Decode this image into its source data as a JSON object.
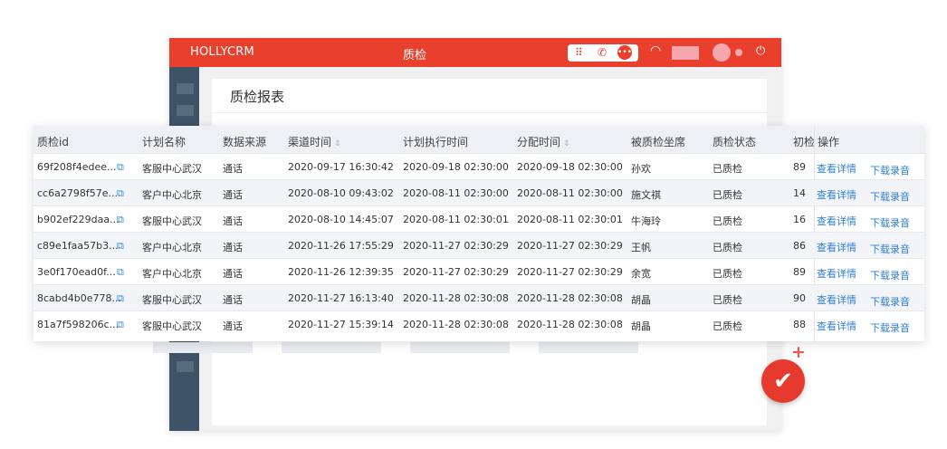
{
  "window": {
    "brand": "HOLLYCRM",
    "title": "质检",
    "panel_title": "质检报表"
  },
  "icons": {
    "grid": "grid-icon",
    "phone": "phone-icon",
    "chat": "chat-icon",
    "wifi": "wifi-icon",
    "power": "power-icon",
    "check": "checkmark-icon"
  },
  "colors": {
    "topbar": "#e8402d",
    "sidebar": "#3e5466",
    "link": "#2e7fd6",
    "badge": "#e63a2e"
  },
  "table": {
    "headers": [
      "质检id",
      "计划名称",
      "数据来源",
      "渠道时间",
      "计划执行时间",
      "分配时间",
      "被质检坐席",
      "质检状态",
      "初检",
      "操作"
    ],
    "rows": [
      {
        "id": "69f208f4edee...",
        "plan": "客服中心武汉",
        "source": "通话",
        "channel_time": "2020-09-17 16:30:42",
        "exec_time": "2020-09-18 02:30:00",
        "assign_time": "2020-09-18 02:30:00",
        "agent": "孙欢",
        "status": "已质检",
        "score": "89",
        "view": "查看详情",
        "download": "下载录音"
      },
      {
        "id": "cc6a2798f57e...",
        "plan": "客户中心北京",
        "source": "通话",
        "channel_time": "2020-08-10 09:43:02",
        "exec_time": "2020-08-11 02:30:00",
        "assign_time": "2020-08-11 02:30:00",
        "agent": "施文祺",
        "status": "已质检",
        "score": "14",
        "view": "查看详情",
        "download": "下载录音"
      },
      {
        "id": "b902ef229daa...",
        "plan": "客服中心武汉",
        "source": "通话",
        "channel_time": "2020-08-10 14:45:07",
        "exec_time": "2020-08-11 02:30:01",
        "assign_time": "2020-08-11 02:30:01",
        "agent": "牛海玲",
        "status": "已质检",
        "score": "16",
        "view": "查看详情",
        "download": "下载录音"
      },
      {
        "id": "c89e1faa57b3...",
        "plan": "客户中心北京",
        "source": "通话",
        "channel_time": "2020-11-26 17:55:29",
        "exec_time": "2020-11-27 02:30:29",
        "assign_time": "2020-11-27 02:30:29",
        "agent": "王帆",
        "status": "已质检",
        "score": "86",
        "view": "查看详情",
        "download": "下载录音"
      },
      {
        "id": "3e0f170ead0f...",
        "plan": "客户中心北京",
        "source": "通话",
        "channel_time": "2020-11-26 12:39:35",
        "exec_time": "2020-11-27 02:30:29",
        "assign_time": "2020-11-27 02:30:29",
        "agent": "余宽",
        "status": "已质检",
        "score": "89",
        "view": "查看详情",
        "download": "下载录音"
      },
      {
        "id": "8cabd4b0e778...",
        "plan": "客服中心武汉",
        "source": "通话",
        "channel_time": "2020-11-27 16:13:40",
        "exec_time": "2020-11-28 02:30:08",
        "assign_time": "2020-11-28 02:30:08",
        "agent": "胡晶",
        "status": "已质检",
        "score": "90",
        "view": "查看详情",
        "download": "下载录音"
      },
      {
        "id": "81a7f598206c...",
        "plan": "客服中心武汉",
        "source": "通话",
        "channel_time": "2020-11-27 15:39:14",
        "exec_time": "2020-11-28 02:30:08",
        "assign_time": "2020-11-28 02:30:08",
        "agent": "胡晶",
        "status": "已质检",
        "score": "88",
        "view": "查看详情",
        "download": "下载录音"
      }
    ]
  }
}
